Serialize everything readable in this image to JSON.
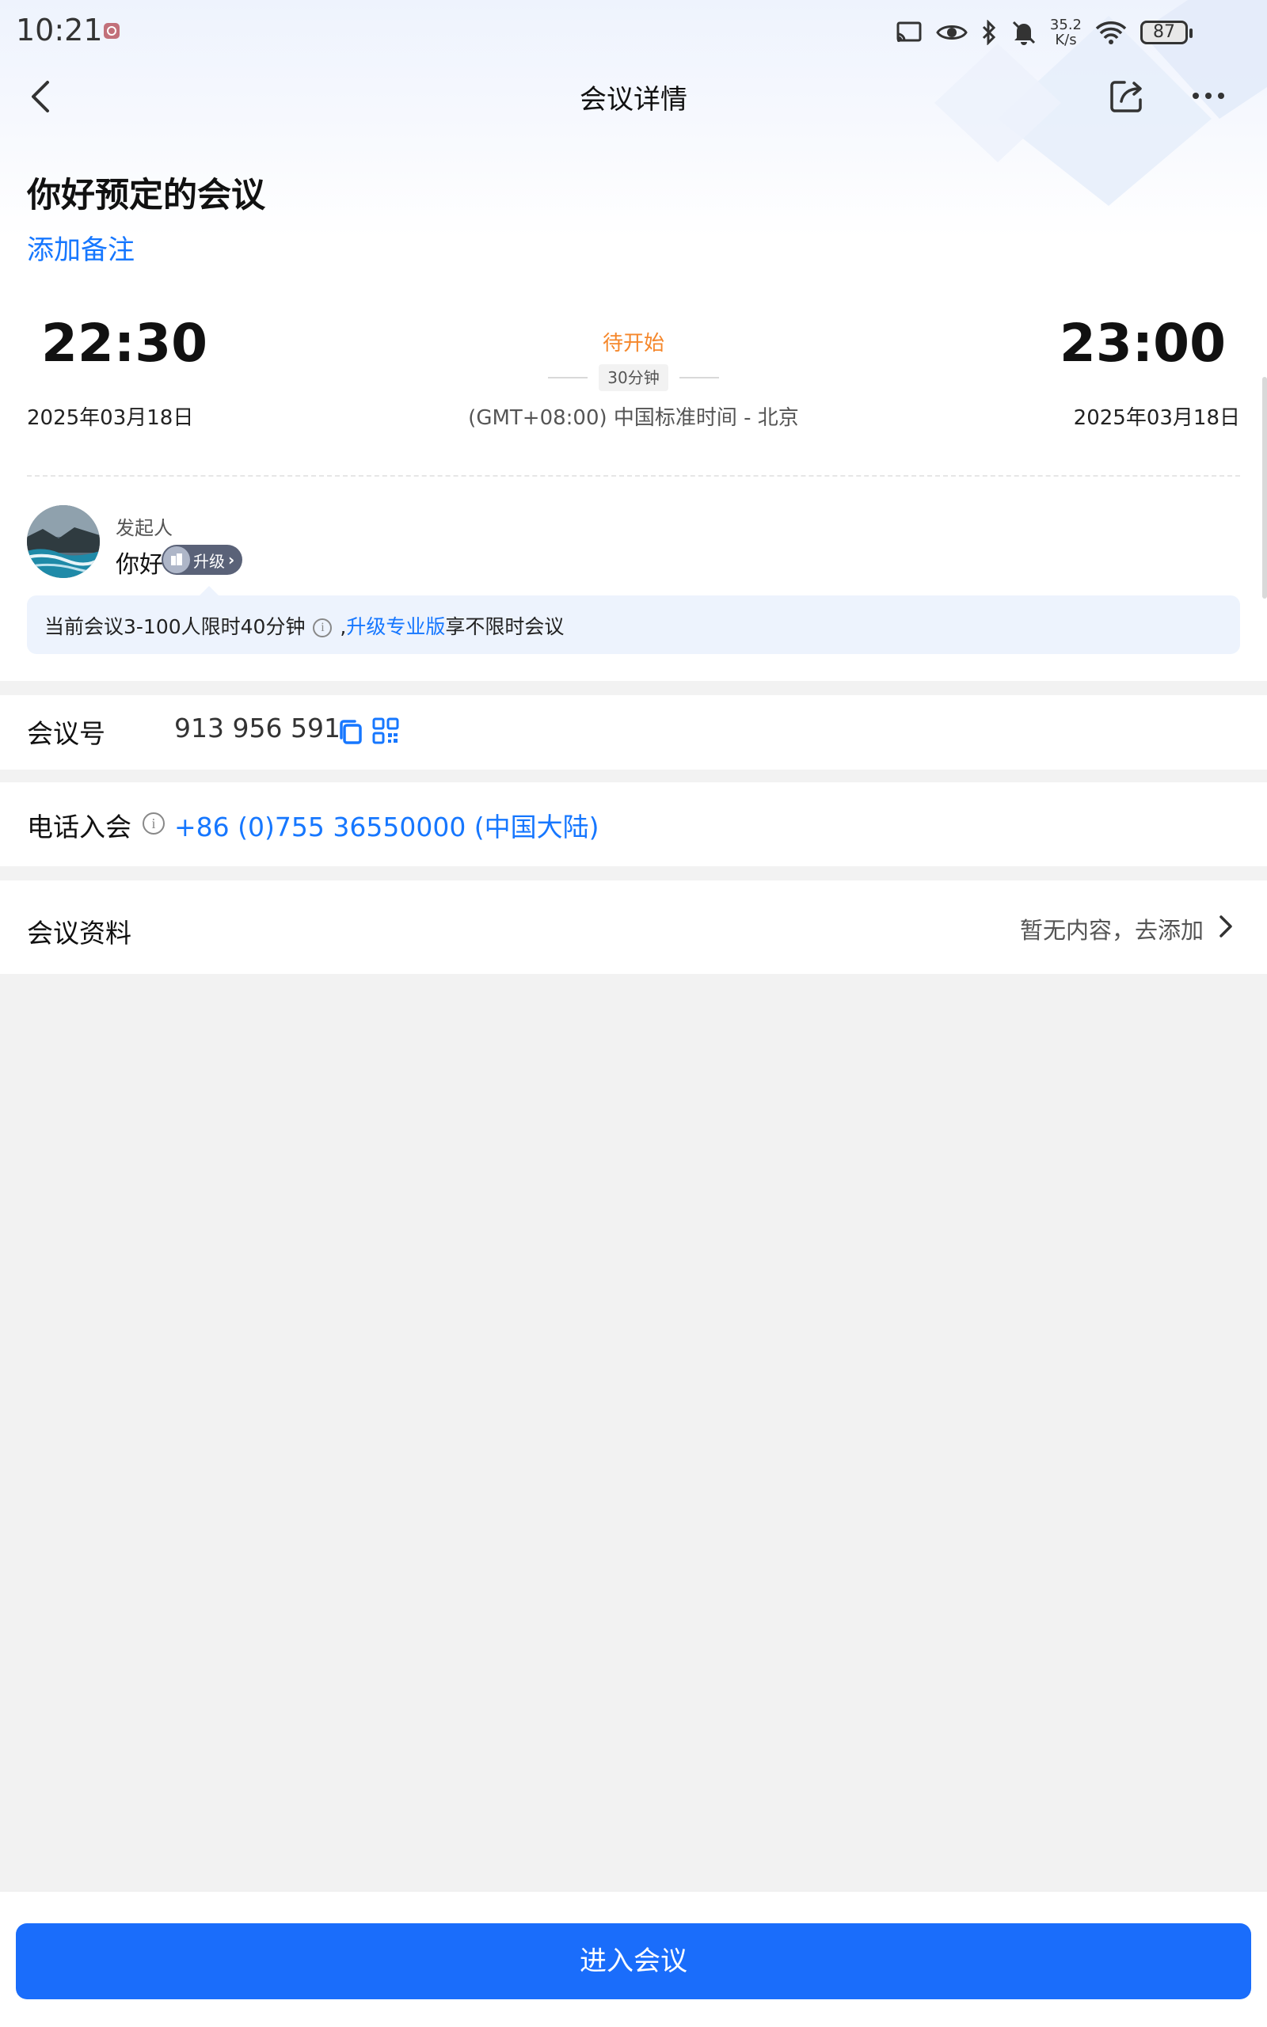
{
  "status_bar": {
    "time": "10:21",
    "net_speed_value": "35.2",
    "net_speed_unit": "K/s",
    "battery": "87"
  },
  "nav": {
    "title": "会议详情"
  },
  "meeting": {
    "title": "你好预定的会议",
    "add_note": "添加备注",
    "start_time": "22:30",
    "end_time": "23:00",
    "start_date": "2025年03月18日",
    "end_date": "2025年03月18日",
    "status": "待开始",
    "duration": "30分钟",
    "timezone": "(GMT+08:00) 中国标准时间 - 北京"
  },
  "host": {
    "label": "发起人",
    "name": "你好",
    "upgrade_label": "升级"
  },
  "notice": {
    "prefix": "当前会议3-100人限时40分钟",
    "separator": ",",
    "link": "升级专业版",
    "suffix": "享不限时会议"
  },
  "meeting_number": {
    "label": "会议号",
    "value": "913 956 591"
  },
  "phone_join": {
    "label": "电话入会",
    "number": "+86 (0)755 36550000 (中国大陆)"
  },
  "materials": {
    "label": "会议资料",
    "status": "暂无内容，去添加"
  },
  "bottom": {
    "join_label": "进入会议"
  },
  "colors": {
    "accent": "#1677ff",
    "button": "#1a6dfb",
    "status_orange": "#f5872b"
  }
}
